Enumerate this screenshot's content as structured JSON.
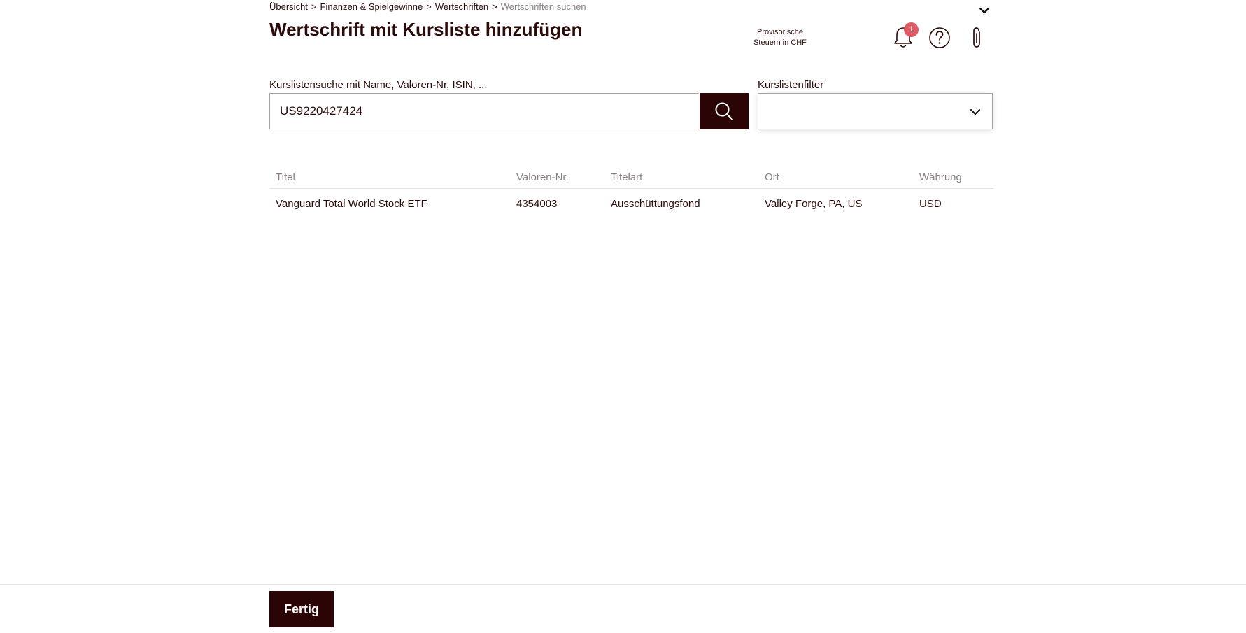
{
  "breadcrumb": {
    "items": [
      "Übersicht",
      "Finanzen & Spielgewinne",
      "Wertschriften"
    ],
    "current": "Wertschriften suchen",
    "separator": ">"
  },
  "page": {
    "title": "Wertschrift mit Kursliste hinzufügen"
  },
  "header": {
    "tax_note_line1": "Provisorische",
    "tax_note_line2": "Steuern in CHF",
    "notification_count": "1",
    "icons": [
      "chevron-down-icon",
      "bell-icon",
      "help-icon",
      "paperclip-icon"
    ]
  },
  "search": {
    "label": "Kurslistensuche mit Name, Valoren-Nr, ISIN, ...",
    "value": "US9220427424",
    "button_icon": "search-icon"
  },
  "filter": {
    "label": "Kurslistenfilter",
    "selected": ""
  },
  "table": {
    "columns": [
      "Titel",
      "Valoren-Nr.",
      "Titelart",
      "Ort",
      "Währung"
    ],
    "rows": [
      [
        "Vanguard Total World Stock ETF",
        "4354003",
        "Ausschüttungsfond",
        "Valley Forge, PA, US",
        "USD"
      ]
    ]
  },
  "footer": {
    "done_label": "Fertig"
  },
  "colors": {
    "primary": "#2b0505",
    "text": "#2b0a0a",
    "muted": "#8a7f7f",
    "badge": "#e05a64"
  }
}
